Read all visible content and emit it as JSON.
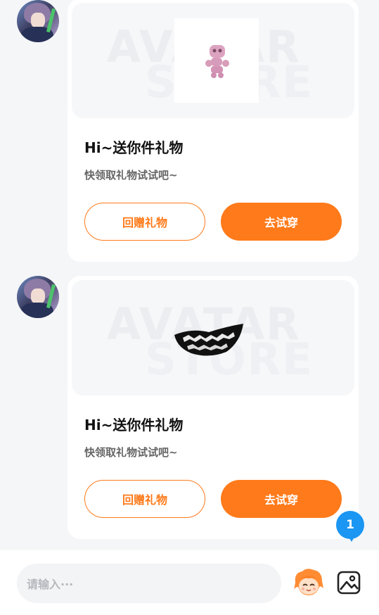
{
  "messages": [
    {
      "bg_text_1": "AVATAR",
      "bg_text_2": "STORE",
      "gift_icon": "pink-figure-icon",
      "title": "Hi~送你件礼物",
      "subtitle": "快领取礼物试试吧~",
      "return_gift_label": "回赠礼物",
      "try_on_label": "去试穿"
    },
    {
      "bg_text_1": "AVATAR",
      "bg_text_2": "STORE",
      "gift_icon": "teeth-mouth-icon",
      "title": "Hi~送你件礼物",
      "subtitle": "快领取礼物试试吧~",
      "return_gift_label": "回赠礼物",
      "try_on_label": "去试穿"
    }
  ],
  "unread_badge": "1",
  "input": {
    "placeholder": "请输入···"
  },
  "colors": {
    "accent": "#ff7a1a",
    "badge": "#1b96f3",
    "background": "#f5f6f8"
  }
}
